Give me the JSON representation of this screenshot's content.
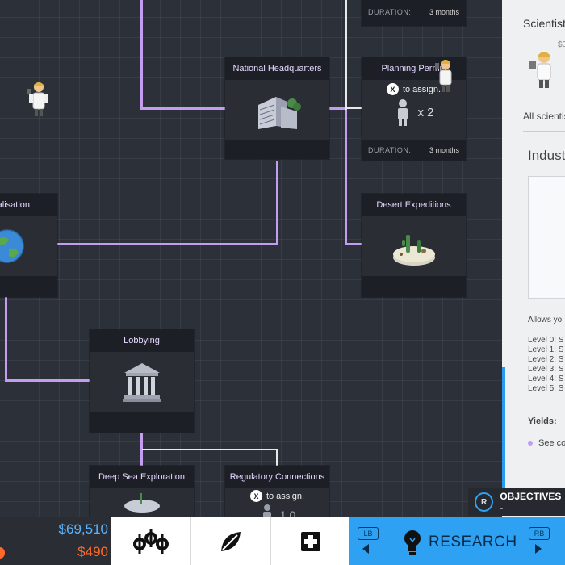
{
  "nodes": {
    "national_hq": {
      "title": "National Headquarters"
    },
    "planning": {
      "title": "Planning Permis",
      "assign_text": "to assign.",
      "assign_button": "X",
      "multiplier": "x 2",
      "duration_label": "DURATION:",
      "duration_value": "3 months"
    },
    "top_partial": {
      "duration_label": "DURATION:",
      "duration_value": "3 months"
    },
    "desert": {
      "title": "Desert Expeditions"
    },
    "globalisation": {
      "title": "alisation"
    },
    "lobbying": {
      "title": "Lobbying"
    },
    "deep_sea": {
      "title": "Deep Sea Exploration"
    },
    "regulatory": {
      "title": "Regulatory Connections",
      "assign_text": "to assign.",
      "assign_button": "X",
      "multiplier": "1 0"
    }
  },
  "panel": {
    "title": "Scientist",
    "sub": "$0",
    "all_scientists": "All scientis",
    "industry": "Indust",
    "allows": "Allows yo",
    "levels": [
      "Level 0: S",
      "Level 1: S",
      "Level 2: S",
      "Level 3: S",
      "Level 4: S",
      "Level 5: S"
    ],
    "yields": "Yields:",
    "yield_item": "See co"
  },
  "bottom": {
    "money": "$69,510",
    "expense": "$490",
    "research_label": "RESEARCH",
    "lb": "LB",
    "rb": "RB",
    "objectives": "OBJECTIVES -",
    "objectives_btn": "R"
  },
  "colors": {
    "connector": "#c49cf0",
    "accent": "#2ea1f2",
    "money": "#5ab4ff",
    "expense": "#ff6a2a"
  }
}
